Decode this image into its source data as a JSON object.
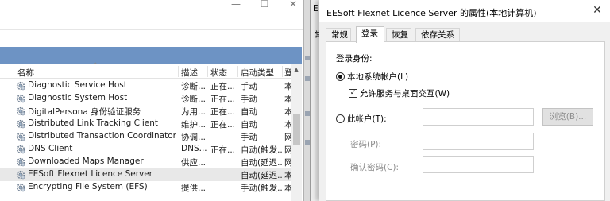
{
  "services_window": {
    "controls": {
      "minimize": "—",
      "maximize": "☐",
      "close": "✕"
    },
    "columns": {
      "name": "名称",
      "description": "描述",
      "status": "状态",
      "startup_type": "启动类型",
      "logon_as": "登"
    },
    "rows": [
      {
        "name": "Diagnostic Service Host",
        "description": "诊断...",
        "status": "正在...",
        "startup_type": "手动",
        "logon_as": "本"
      },
      {
        "name": "Diagnostic System Host",
        "description": "诊断...",
        "status": "正在...",
        "startup_type": "手动",
        "logon_as": "本"
      },
      {
        "name": "DigitalPersona 身份验证服务",
        "description": "为用...",
        "status": "正在...",
        "startup_type": "自动",
        "logon_as": "本"
      },
      {
        "name": "Distributed Link Tracking Client",
        "description": "维护...",
        "status": "正在...",
        "startup_type": "自动",
        "logon_as": "本"
      },
      {
        "name": "Distributed Transaction Coordinator",
        "description": "协调...",
        "status": "",
        "startup_type": "手动",
        "logon_as": "网"
      },
      {
        "name": "DNS Client",
        "description": "DNS...",
        "status": "正在...",
        "startup_type": "自动(触发...",
        "logon_as": "网"
      },
      {
        "name": "Downloaded Maps Manager",
        "description": "供应...",
        "status": "",
        "startup_type": "自动(延迟...",
        "logon_as": "网"
      },
      {
        "name": "EESoft Flexnet Licence Server",
        "description": "",
        "status": "",
        "startup_type": "自动(延迟...",
        "logon_as": "本"
      },
      {
        "name": "Encrypting File System (EFS)",
        "description": "提供...",
        "status": "",
        "startup_type": "手动(触发...",
        "logon_as": "本"
      }
    ],
    "selected_row": 7
  },
  "background_window": {
    "title": "EE",
    "tab": "常"
  },
  "dialog": {
    "title": "EESoft Flexnet Licence Server 的属性(本地计算机)",
    "close": "✕",
    "tabs": [
      "常规",
      "登录",
      "恢复",
      "依存关系"
    ],
    "active_tab": 1,
    "logon_as_label": "登录身份:",
    "local_system_label": "本地系统帐户(L)",
    "interact_label": "允许服务与桌面交互(W)",
    "this_account_label": "此帐户(T):",
    "password_label": "密码(P):",
    "confirm_label": "确认密码(C):",
    "browse_label": "浏览(B)...",
    "local_system_selected": true,
    "interact_checked": true
  }
}
